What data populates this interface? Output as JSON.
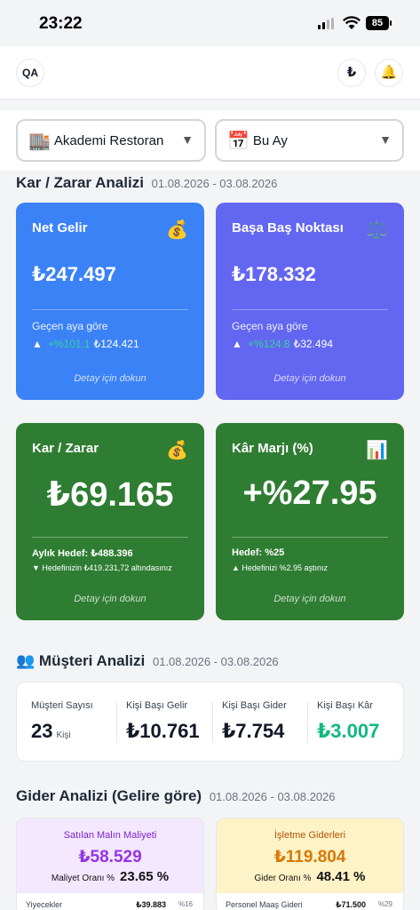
{
  "status": {
    "time": "23:22",
    "battery": "85"
  },
  "topbar": {
    "avatar": "QA",
    "currency_icon": "₺"
  },
  "filters": {
    "restaurant": "Akademi Restoran",
    "period": "Bu Ay"
  },
  "profit_section": {
    "title": "Kar / Zarar Analizi",
    "range": "01.08.2026 - 03.08.2026"
  },
  "cards": {
    "net": {
      "title": "Net Gelir",
      "value": "₺247.497",
      "sub": "Geçen aya göre",
      "pct": "+%101.1",
      "prev": "₺124.421",
      "hint": "Detay için dokun"
    },
    "breakeven": {
      "title": "Başa Baş Noktası",
      "value": "₺178.332",
      "sub": "Geçen aya göre",
      "pct": "+%124.8",
      "prev": "₺32.494",
      "hint": "Detay için dokun"
    },
    "profit": {
      "title": "Kar / Zarar",
      "value": "₺69.165",
      "goal": "Aylık Hedef: ₺488.396",
      "note": "Hedefinizin ₺419.231,72 altındasınız",
      "hint": "Detay için dokun"
    },
    "margin": {
      "title": "Kâr Marjı (%)",
      "value": "+%27.95",
      "goal": "Hedef: %25",
      "note": "Hedefinizi %2.95 aştınız",
      "hint": "Detay için dokun"
    }
  },
  "customer_section": {
    "title": "Müşteri Analizi",
    "range": "01.08.2026 - 03.08.2026"
  },
  "customers": {
    "count_label": "Müşteri Sayısı",
    "count": "23",
    "count_unit": "Kişi",
    "income_label": "Kişi Başı Gelir",
    "income": "₺10.761",
    "expense_label": "Kişi Başı Gider",
    "expense": "₺7.754",
    "profit_label": "Kişi Başı Kâr",
    "profit": "₺3.007"
  },
  "expense_section": {
    "title": "Gider Analizi (Gelire göre)",
    "range": "01.08.2026 - 03.08.2026"
  },
  "expenses": {
    "cogs": {
      "title": "Satılan Malın Maliyeti",
      "value": "₺58.529",
      "ratio_label": "Maliyet Oranı %",
      "ratio": "23.65 %",
      "row_label": "Yiyecekler",
      "row_value": "₺39.883",
      "row_pct": "%16"
    },
    "opex": {
      "title": "İşletme Giderleri",
      "value": "₺119.804",
      "ratio_label": "Gider Oranı %",
      "ratio": "48.41 %",
      "row_label": "Personel Maaş Gideri",
      "row_value": "₺71.500",
      "row_pct": "%29"
    }
  },
  "colors": {
    "blue": "#3b82f6",
    "indigo": "#6366f1",
    "green": "#2e7d32",
    "profit_green": "#10b981",
    "cogs_purple": "#9333ea",
    "opex_orange": "#d97706"
  }
}
